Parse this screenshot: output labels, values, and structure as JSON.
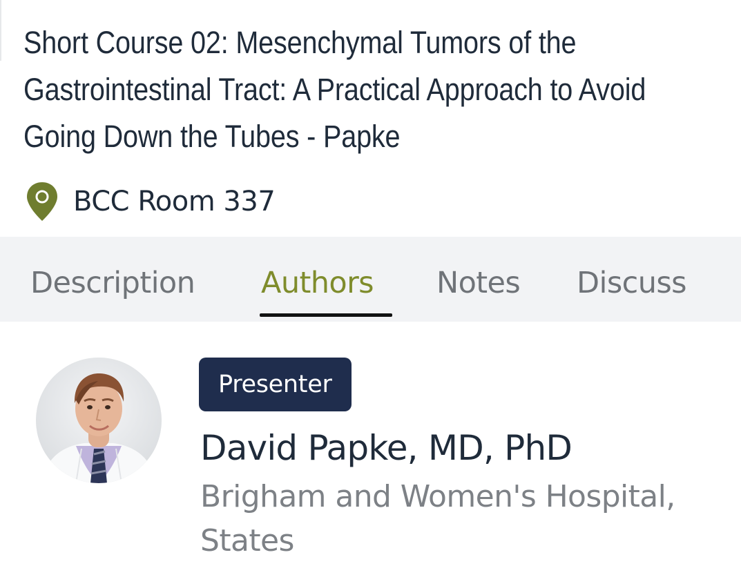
{
  "session": {
    "title": "Short Course 02: Mesenchymal Tumors of the Gastrointestinal Tract: A Practical Approach to Avoid Going Down the Tubes - Papke",
    "location": "BCC Room 337"
  },
  "tabs": [
    {
      "label": "Description",
      "active": false
    },
    {
      "label": "Authors",
      "active": true
    },
    {
      "label": "Notes",
      "active": false
    },
    {
      "label": "Discuss",
      "active": false
    }
  ],
  "author": {
    "role_badge": "Presenter",
    "name": "David Papke, MD, PhD",
    "affiliation": "Brigham and Women's Hospital, States"
  },
  "icons": {
    "location": "map-pin-icon"
  },
  "colors": {
    "accent": "#7f8c2c",
    "pin": "#6f7d2f",
    "badge_background": "#1f2d4d",
    "title_text": "#1f2b3a",
    "tab_text": "#6f7378",
    "tab_bar_background": "#f2f3f5",
    "affiliation_text": "#7d8186"
  }
}
